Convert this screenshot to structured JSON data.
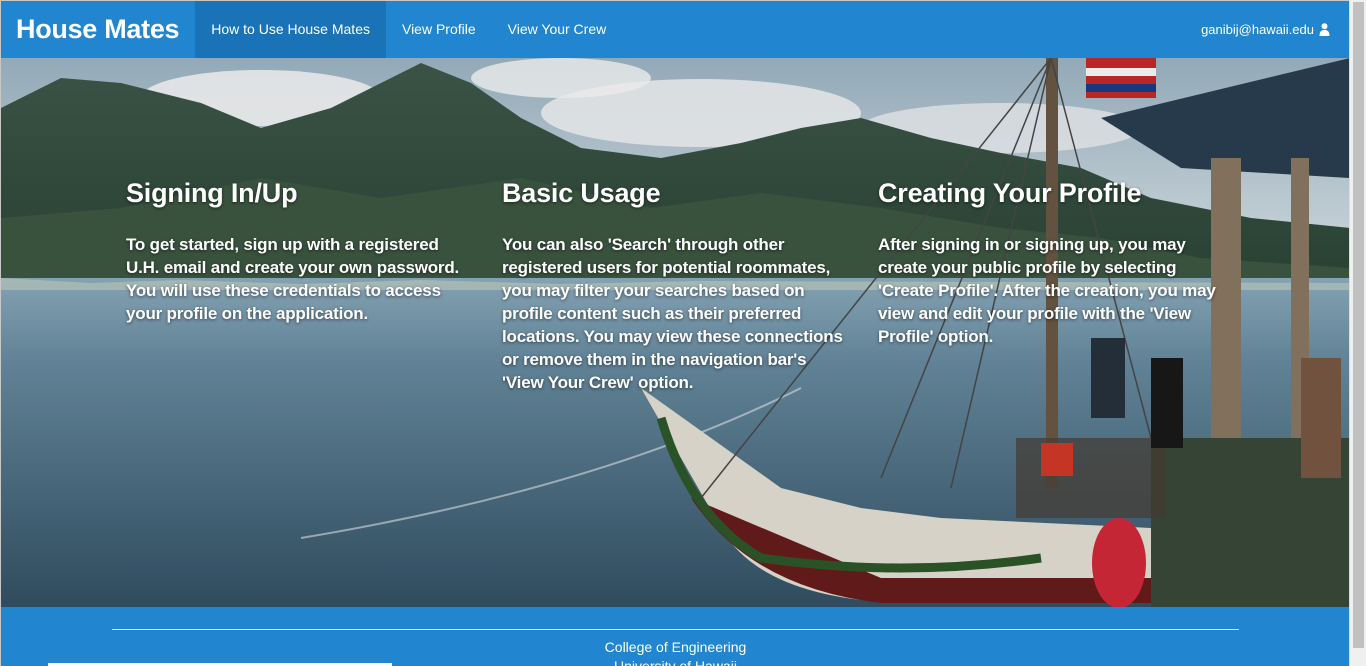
{
  "navbar": {
    "brand": "House Mates",
    "items": [
      {
        "label": "How to Use House Mates",
        "active": true
      },
      {
        "label": "View Profile",
        "active": false
      },
      {
        "label": "View Your Crew",
        "active": false
      }
    ],
    "user_email": "ganibij@hawaii.edu",
    "user_icon": "user-icon",
    "color": "#2185d0"
  },
  "sections": [
    {
      "title": "Signing In/Up",
      "body": "To get started, sign up with a registered U.H. email and create your own password. You will use these credentials to access your profile on the application."
    },
    {
      "title": "Basic Usage",
      "body": "You can also 'Search' through other registered users for potential roommates, you may filter your searches based on profile content such as their preferred locations. You may view these connections or remove them in the navigation bar's 'View Your Crew' option."
    },
    {
      "title": "Creating Your Profile",
      "body": "After signing in or signing up, you may create your public profile by selecting 'Create Profile'. After the creation, you may view and edit your profile with the 'View Profile' option."
    }
  ],
  "footer": {
    "line1": "College of Engineering",
    "line2": "University of Hawaii",
    "color": "#2185d0"
  }
}
